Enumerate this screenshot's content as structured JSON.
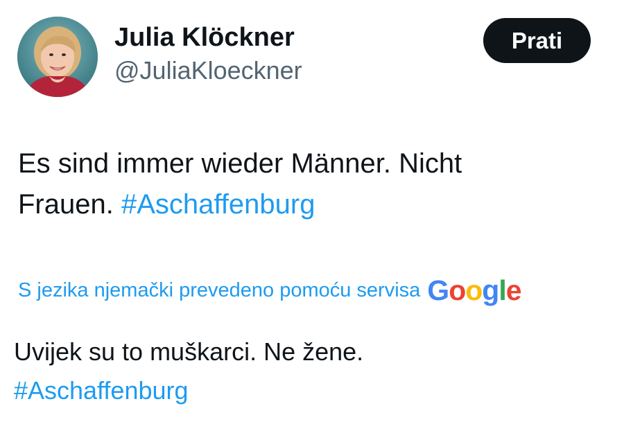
{
  "author": {
    "display_name": "Julia Klöckner",
    "handle": "@JuliaKloeckner",
    "avatar_icon": "profile-photo"
  },
  "follow_button": {
    "label": "Prati"
  },
  "tweet": {
    "text_line1": "Es sind immer wieder Männer. Nicht",
    "text_line2": "Frauen.",
    "hashtag": "#Aschaffenburg"
  },
  "translation": {
    "note": "S jezika njemački prevedeno pomoću servisa",
    "provider_letters": [
      "G",
      "o",
      "o",
      "g",
      "l",
      "e"
    ],
    "translated_line1": "Uvijek su to muškarci. Ne žene.",
    "translated_hashtag": "#Aschaffenburg"
  },
  "colors": {
    "link": "#1d9bf0",
    "text": "#0f1419",
    "secondary_text": "#536471",
    "button_bg": "#0f1419"
  }
}
